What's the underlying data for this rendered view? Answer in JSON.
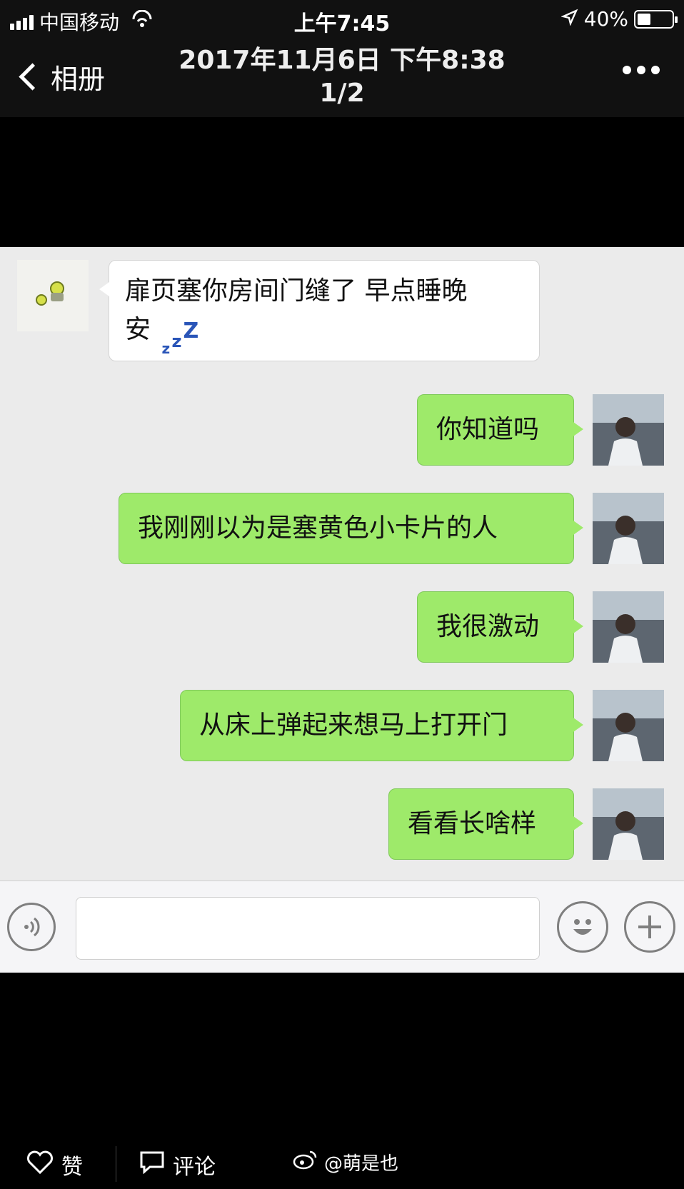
{
  "status_bar": {
    "carrier": "中国移动",
    "time": "上午7:45",
    "battery": "40%",
    "battery_level": 0.4
  },
  "nav": {
    "back_label": "相册",
    "title_date": "2017年11月6日 下午8:38",
    "title_index": "1/2"
  },
  "messages": [
    {
      "side": "in",
      "lines": [
        "扉页塞你房间门缝了 早点睡晚",
        "安"
      ],
      "has_zzz": true
    },
    {
      "side": "out",
      "text": "你知道吗"
    },
    {
      "side": "out",
      "text": "我刚刚以为是塞黄色小卡片的人"
    },
    {
      "side": "out",
      "text": "我很激动"
    },
    {
      "side": "out",
      "text": "从床上弹起来想马上打开门"
    },
    {
      "side": "out",
      "text": "看看长啥样"
    }
  ],
  "zzz": [
    "z",
    "z",
    "Z"
  ],
  "footer": {
    "like_label": "赞",
    "comment_label": "评论",
    "watermark": "@萌是也"
  },
  "colors": {
    "chat_bg": "#ebebeb",
    "out_bubble": "#9eea6a",
    "in_bubble": "#ffffff",
    "zzz": "#2a55b8"
  },
  "icons": [
    "signal-icon",
    "wifi-icon",
    "location-arrow-icon",
    "battery-icon",
    "back-chevron-icon",
    "more-icon",
    "voice-icon",
    "emoji-icon",
    "plus-icon",
    "heart-icon",
    "comment-icon",
    "weibo-icon"
  ]
}
